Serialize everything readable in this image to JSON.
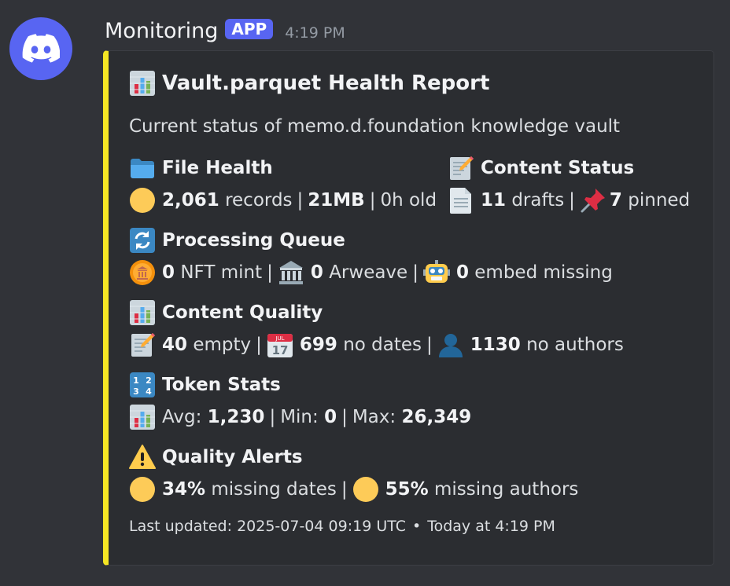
{
  "message": {
    "username": "Monitoring",
    "badge": "APP",
    "time": "4:19 PM"
  },
  "embed": {
    "accent": "#f5e624",
    "title": "Vault.parquet Health Report",
    "description": "Current status of memo.d.foundation knowledge vault",
    "fields": {
      "file_health": {
        "name": "File Health",
        "records": "2,061",
        "records_label": "records",
        "size": "21MB",
        "age": "0h old"
      },
      "content_status": {
        "name": "Content Status",
        "drafts": "11",
        "drafts_label": "drafts",
        "pinned": "7",
        "pinned_label": "pinned"
      },
      "processing_queue": {
        "name": "Processing Queue",
        "nft": "0",
        "nft_label": "NFT mint",
        "arweave": "0",
        "arweave_label": "Arweave",
        "embed": "0",
        "embed_label": "embed missing"
      },
      "content_quality": {
        "name": "Content Quality",
        "empty": "40",
        "empty_label": "empty",
        "nodates": "699",
        "nodates_label": "no dates",
        "noauthors": "1130",
        "noauthors_label": "no authors"
      },
      "token_stats": {
        "name": "Token Stats",
        "avg_label": "Avg:",
        "avg": "1,230",
        "min_label": "Min:",
        "min": "0",
        "max_label": "Max:",
        "max": "26,349"
      },
      "quality_alerts": {
        "name": "Quality Alerts",
        "dates_pct": "34%",
        "dates_label": "missing dates",
        "authors_pct": "55%",
        "authors_label": "missing authors"
      }
    },
    "footer": {
      "text": "Last updated: 2025-07-04 09:19 UTC",
      "time": "Today at 4:19 PM"
    },
    "icons": {
      "title": "bar-chart-icon",
      "file_health": "folder-icon",
      "content_status": "memo-icon",
      "processing_queue": "refresh-icon",
      "content_quality": "bar-chart-icon",
      "token_stats": "numbers-icon",
      "quality_alerts": "warning-icon"
    }
  }
}
